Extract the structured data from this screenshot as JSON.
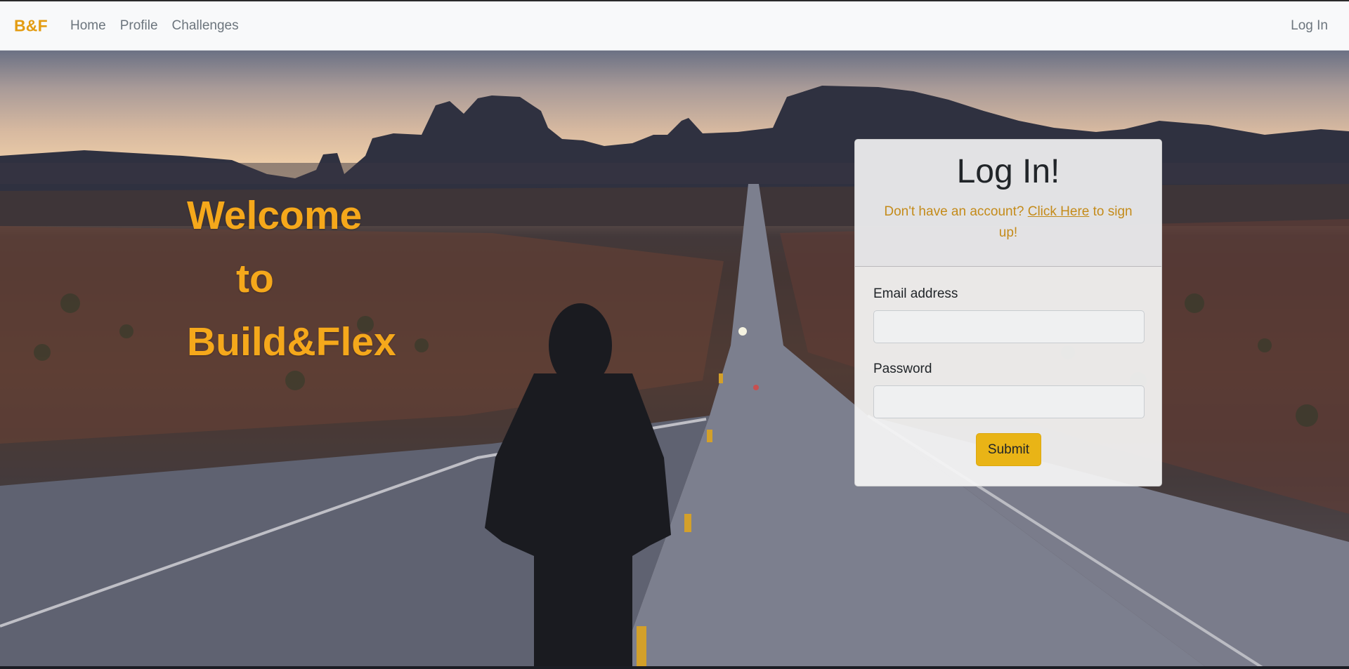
{
  "navbar": {
    "brand": "B&F",
    "links": [
      "Home",
      "Profile",
      "Challenges"
    ],
    "right_link": "Log In"
  },
  "hero": {
    "welcome_lines": [
      "Welcome",
      "to",
      "Build&Flex"
    ],
    "background_description": "desert road at dusk with hooded person walking"
  },
  "login_card": {
    "title": "Log In!",
    "signup_prefix": "Don't have an account?",
    "signup_link": "Click Here",
    "signup_suffix": "to sign up!",
    "email_label": "Email address",
    "email_value": "",
    "password_label": "Password",
    "password_value": "",
    "submit_label": "Submit"
  },
  "colors": {
    "brand": "#e39c12",
    "welcome_text": "#f5a81b",
    "link_orange": "#c48b1a",
    "submit_bg": "#e9b416",
    "navbar_bg": "#f8f9fa"
  }
}
